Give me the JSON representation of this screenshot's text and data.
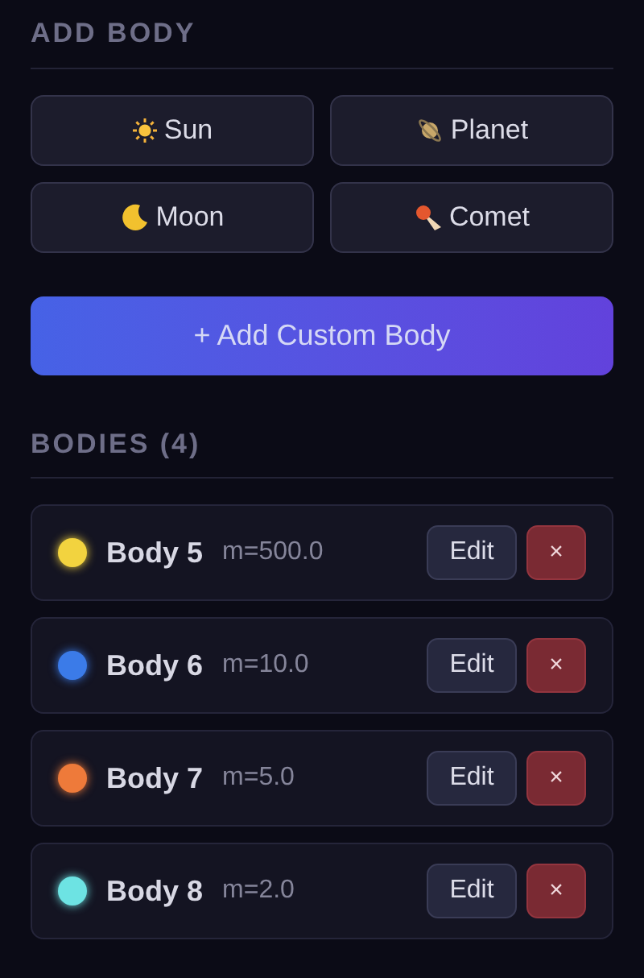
{
  "add_section": {
    "title": "ADD BODY",
    "presets": [
      {
        "kind": "sun",
        "label": "Sun"
      },
      {
        "kind": "planet",
        "label": "Planet"
      },
      {
        "kind": "moon",
        "label": "Moon"
      },
      {
        "kind": "comet",
        "label": "Comet"
      }
    ],
    "custom_button": "+ Add Custom Body"
  },
  "bodies_section": {
    "title": "BODIES (4)",
    "bodies": [
      {
        "name": "Body 5",
        "mass": "m=500.0",
        "color": "#f2d33f",
        "edit": "Edit",
        "remove": "×"
      },
      {
        "name": "Body 6",
        "mass": "m=10.0",
        "color": "#3b7be8",
        "edit": "Edit",
        "remove": "×"
      },
      {
        "name": "Body 7",
        "mass": "m=5.0",
        "color": "#ee7a3a",
        "edit": "Edit",
        "remove": "×"
      },
      {
        "name": "Body 8",
        "mass": "m=2.0",
        "color": "#6de3e3",
        "edit": "Edit",
        "remove": "×"
      }
    ]
  }
}
